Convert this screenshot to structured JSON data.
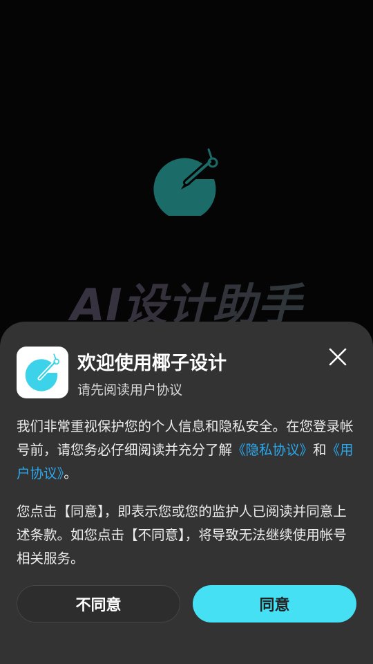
{
  "splash": {
    "logo_icon": "pen-palette-icon",
    "logo_color": "#1b6b68",
    "title": "AI设计助手"
  },
  "dialog": {
    "app_icon": "pen-palette-icon",
    "app_icon_color": "#3cd3ea",
    "title": "欢迎使用椰子设计",
    "subtitle": "请先阅读用户协议",
    "close_icon": "close-icon",
    "paragraph1": {
      "text1": "我们非常重视保护您的个人信息和隐私安全。在您登录帐号前，请您务必仔细阅读并充分了解",
      "privacy_link": "《隐私协议》",
      "text2": "和",
      "user_link": "《用户协议》",
      "text3": "。"
    },
    "paragraph2": "您点击【同意】，即表示您或您的监护人已阅读并同意上述条款。如您点击【不同意】，将导致无法继续使用帐号相关服务。",
    "disagree_label": "不同意",
    "agree_label": "同意",
    "link_color": "#2aa8ee",
    "agree_color": "#45e0f4"
  }
}
